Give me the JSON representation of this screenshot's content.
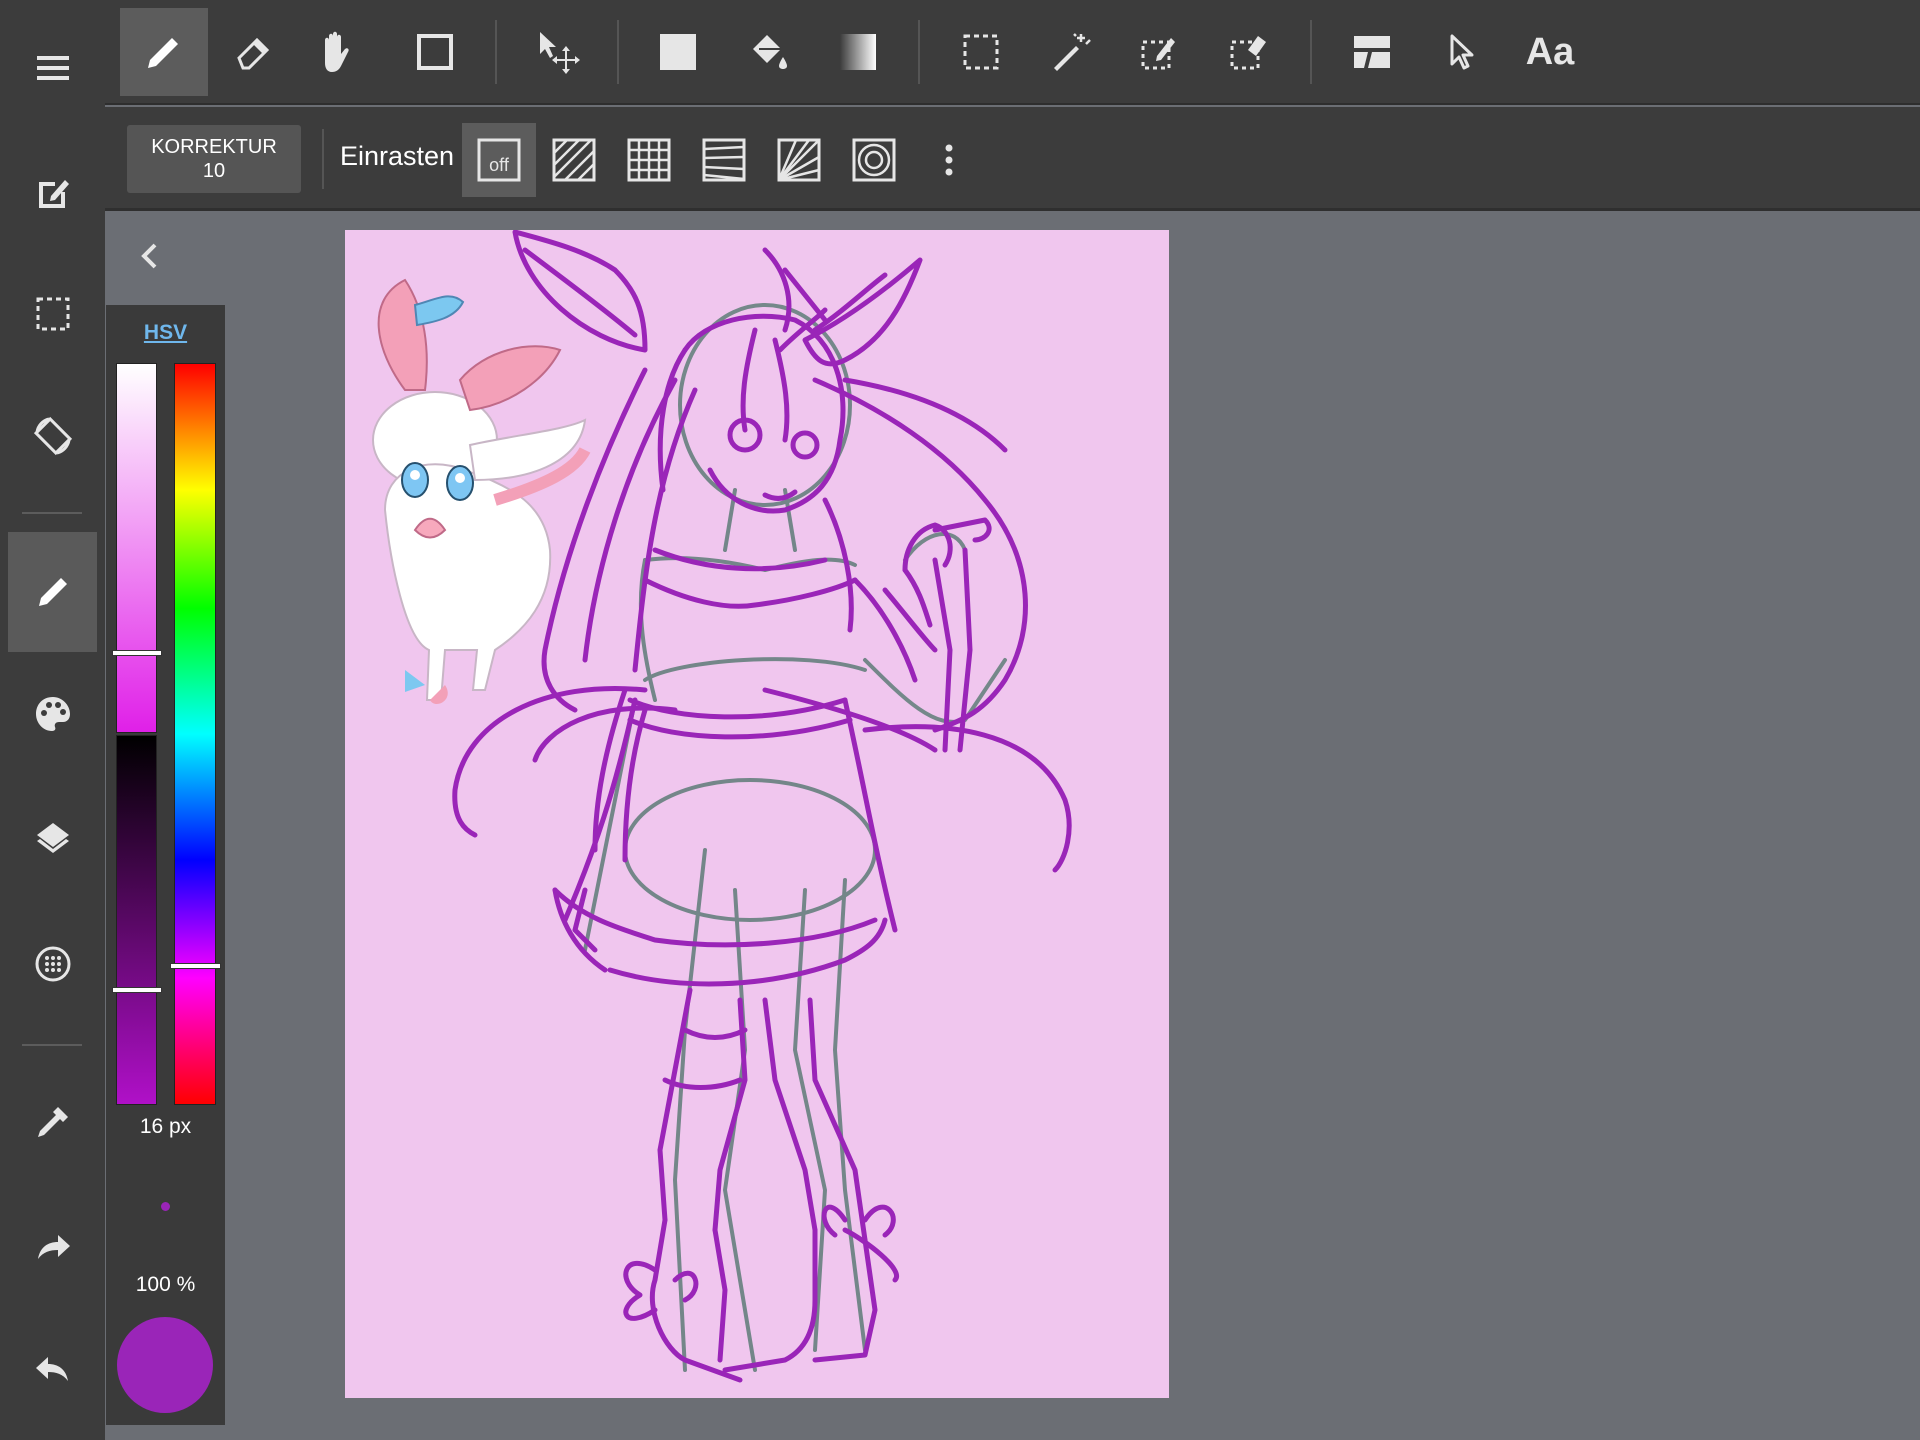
{
  "toolbar": {
    "tools": [
      {
        "name": "pen-tool",
        "icon": "pencil-icon",
        "active": true
      },
      {
        "name": "eraser-tool",
        "icon": "eraser-icon"
      },
      {
        "name": "hand-tool",
        "icon": "hand-icon"
      },
      {
        "name": "shape-tool",
        "icon": "square-outline-icon"
      },
      {
        "name": "move-tool",
        "icon": "move-arrows-icon"
      },
      {
        "name": "fill-rect-tool",
        "icon": "filled-square-icon"
      },
      {
        "name": "bucket-tool",
        "icon": "paint-bucket-icon"
      },
      {
        "name": "gradient-tool",
        "icon": "gradient-icon"
      },
      {
        "name": "select-rect-tool",
        "icon": "selection-rect-icon"
      },
      {
        "name": "magic-wand-tool",
        "icon": "magic-wand-icon"
      },
      {
        "name": "select-pen-tool",
        "icon": "select-pen-icon"
      },
      {
        "name": "select-eraser-tool",
        "icon": "select-eraser-icon"
      },
      {
        "name": "frame-divider-tool",
        "icon": "frame-divider-icon"
      },
      {
        "name": "operation-tool",
        "icon": "pointer-icon"
      }
    ],
    "text_tool_label": "Aa"
  },
  "subbar": {
    "correction_label": "KORREKTUR",
    "correction_value": "10",
    "snap_label": "Einrasten",
    "snap_off_label": "off",
    "snap_modes": [
      "parallel-snap-icon",
      "grid-snap-icon",
      "perspective-snap-icon",
      "radial-snap-icon",
      "circle-snap-icon"
    ],
    "more_icon": "more-vertical-icon"
  },
  "sidebar": {
    "items": [
      {
        "name": "menu-icon"
      },
      {
        "name": "edit-icon"
      },
      {
        "name": "selection-icon"
      },
      {
        "name": "rotate-icon"
      },
      {
        "name": "brush-icon",
        "active": true
      },
      {
        "name": "palette-icon"
      },
      {
        "name": "layers-icon"
      },
      {
        "name": "material-icon"
      },
      {
        "name": "eyedropper-icon"
      },
      {
        "name": "redo-icon"
      },
      {
        "name": "undo-icon"
      }
    ]
  },
  "color_panel": {
    "mode_label": "HSV",
    "brush_size": "16 px",
    "opacity": "100 %",
    "current_color": "#9a25b8"
  },
  "canvas": {
    "background": "#f0c6ee",
    "stroke_color": "#9a25b8",
    "sketch_color": "#5f7c78"
  }
}
